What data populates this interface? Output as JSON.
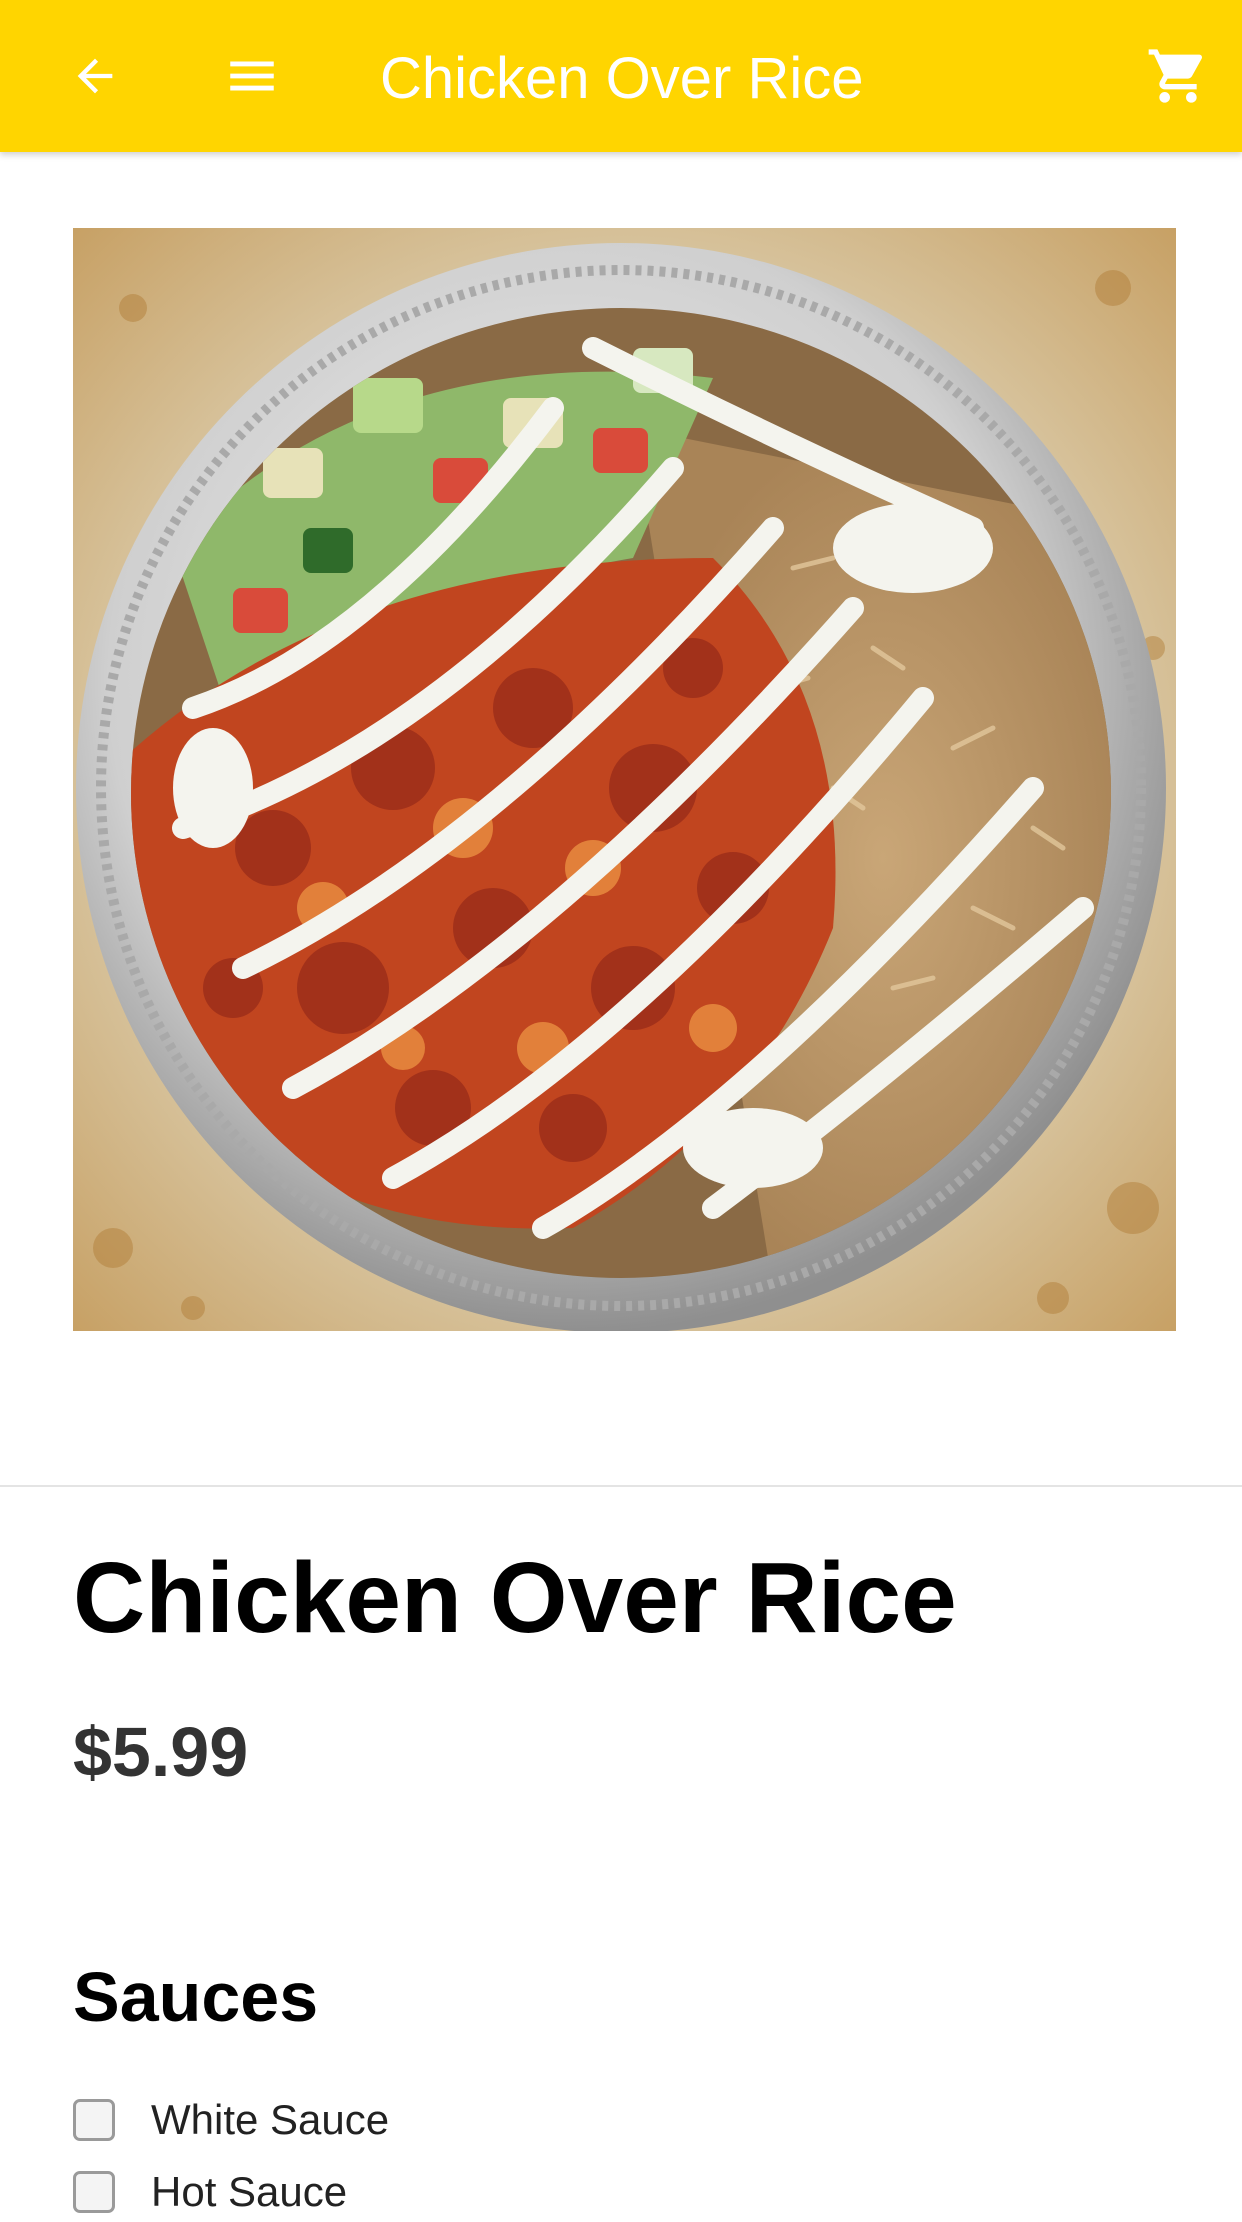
{
  "app_bar": {
    "title": "Chicken Over Rice",
    "background": "#FFD500",
    "icons": [
      "back-arrow-icon",
      "menu-icon",
      "cart-icon"
    ]
  },
  "product": {
    "name": "Chicken Over Rice",
    "price": "$5.99",
    "image": "photo of chicken over rice platter with white sauce, hot sauce, rice and salad in a foil tray"
  },
  "options": {
    "title": "Sauces",
    "items": [
      {
        "label": "White Sauce",
        "checked": false
      },
      {
        "label": "Hot Sauce",
        "checked": false
      }
    ]
  }
}
